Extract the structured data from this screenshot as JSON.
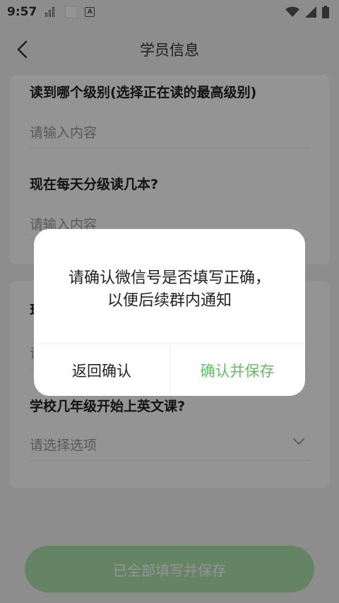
{
  "status_bar": {
    "time": "9:57",
    "badge_letter": "A"
  },
  "nav": {
    "title": "学员信息"
  },
  "form": {
    "fields": [
      {
        "label": "读到哪个级别(选择正在读的最高级别)",
        "placeholder": "请输入内容"
      },
      {
        "label": "现在每天分级读几本?",
        "placeholder": "请输入内容"
      },
      {
        "label": "现",
        "placeholder": "请"
      },
      {
        "label": "学校几年级开始上英文课?",
        "placeholder": "请选择选项"
      }
    ]
  },
  "bottom_button": {
    "label": "已全部填写并保存"
  },
  "dialog": {
    "message": "请确认微信号是否填写正确， 以便后续群内通知",
    "cancel_label": "返回确认",
    "confirm_label": "确认并保存"
  },
  "colors": {
    "accent": "#5cc35e",
    "button_bg": "#aee3ac",
    "overlay": "#000000"
  }
}
